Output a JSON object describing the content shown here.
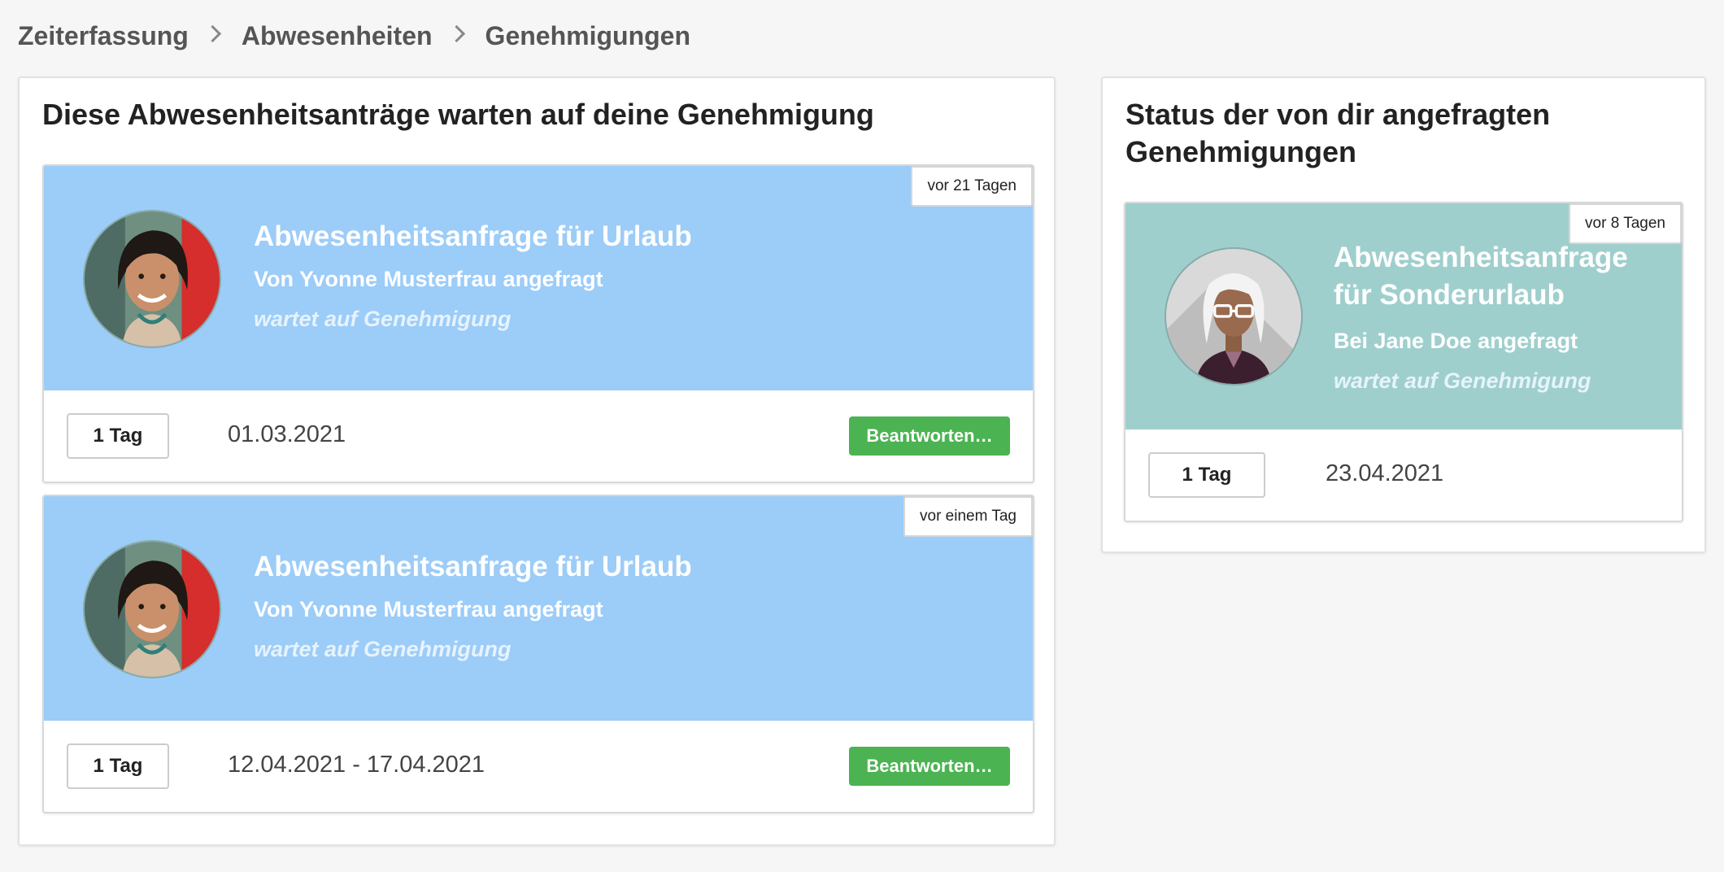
{
  "breadcrumb": {
    "items": [
      "Zeiterfassung",
      "Abwesenheiten",
      "Genehmigungen"
    ]
  },
  "pending": {
    "title": "Diese Abwesenheitsanträge warten auf deine Genehmigung",
    "cards": [
      {
        "age": "vor 21 Tagen",
        "title": "Abwesenheitsanfrage für Urlaub",
        "subtitle": "Von Yvonne Musterfrau angefragt",
        "status": "wartet auf Genehmigung",
        "days": "1 Tag",
        "date": "01.03.2021",
        "button": "Beantworten…"
      },
      {
        "age": "vor einem Tag",
        "title": "Abwesenheitsanfrage für Urlaub",
        "subtitle": "Von Yvonne Musterfrau angefragt",
        "status": "wartet auf Genehmigung",
        "days": "1 Tag",
        "date": "12.04.2021 - 17.04.2021",
        "button": "Beantworten…"
      }
    ]
  },
  "requested": {
    "title": "Status der von dir angefragten Genehmigungen",
    "cards": [
      {
        "age": "vor 8 Tagen",
        "title": "Abwesenheitsanfrage für Sonderurlaub",
        "subtitle": "Bei Jane Doe angefragt",
        "status": "wartet auf Genehmigung",
        "days": "1 Tag",
        "date": "23.04.2021"
      }
    ]
  },
  "colors": {
    "card_blue": "#9cccf8",
    "card_teal": "#9fcfcd",
    "button_green": "#4cb352",
    "background": "#f6f6f6"
  }
}
